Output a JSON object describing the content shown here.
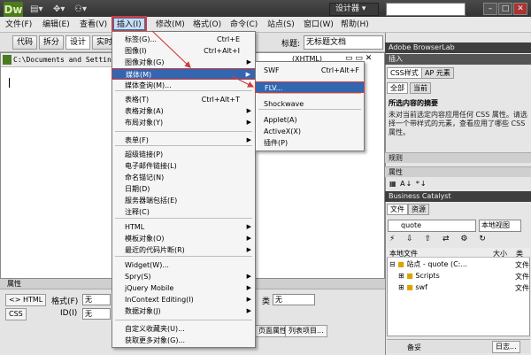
{
  "app": {
    "logo": "Dw",
    "workspace_switch": "设计器 ▾"
  },
  "menubar": {
    "items": [
      "文件(F)",
      "编辑(E)",
      "查看(V)",
      "插入(I)",
      "修改(M)",
      "格式(O)",
      "命令(C)",
      "站点(S)",
      "窗口(W)",
      "帮助(H)"
    ]
  },
  "toolbar": {
    "code": "代码",
    "split": "拆分",
    "design": "设计",
    "live": "实时",
    "title_label": "标题:",
    "title_value": "无标题文档"
  },
  "document": {
    "path": "C:\\Documents and Settings",
    "badge": "(XHTML)",
    "controls": "▭ ▭ ✕"
  },
  "properties": {
    "header": "属性",
    "html_tab": "<> HTML",
    "css_tab": "CSS",
    "format_label": "格式(F)",
    "format_value": "无",
    "class_label": "类",
    "class_value": "无",
    "id_label": "ID(I)",
    "id_value": "无",
    "page_props": "页面属性...",
    "list_item": "列表项目..."
  },
  "insert_menu": {
    "items": [
      {
        "label": "标签(G)...",
        "shortcut": "Ctrl+E",
        "submenu": false
      },
      {
        "label": "图像(I)",
        "shortcut": "Ctrl+Alt+I",
        "submenu": false
      },
      {
        "label": "图像对象(G)",
        "shortcut": "",
        "submenu": true
      },
      {
        "label": "媒体(M)",
        "shortcut": "",
        "submenu": true
      },
      {
        "label": "媒体查询(M)...",
        "shortcut": "",
        "submenu": false
      },
      {
        "label": "表格(T)",
        "shortcut": "Ctrl+Alt+T",
        "submenu": false
      },
      {
        "label": "表格对象(A)",
        "shortcut": "",
        "submenu": true
      },
      {
        "label": "布局对象(Y)",
        "shortcut": "",
        "submenu": true
      },
      {
        "label": "表单(F)",
        "shortcut": "",
        "submenu": true
      },
      {
        "label": "超级链接(P)",
        "shortcut": "",
        "submenu": false
      },
      {
        "label": "电子邮件链接(L)",
        "shortcut": "",
        "submenu": false
      },
      {
        "label": "命名锚记(N)",
        "shortcut": "",
        "submenu": false
      },
      {
        "label": "日期(D)",
        "shortcut": "",
        "submenu": false
      },
      {
        "label": "服务器端包括(E)",
        "shortcut": "",
        "submenu": false
      },
      {
        "label": "注释(C)",
        "shortcut": "",
        "submenu": false
      },
      {
        "label": "HTML",
        "shortcut": "",
        "submenu": true
      },
      {
        "label": "模板对象(O)",
        "shortcut": "",
        "submenu": true
      },
      {
        "label": "最近的代码片断(R)",
        "shortcut": "",
        "submenu": true
      },
      {
        "label": "Widget(W)...",
        "shortcut": "",
        "submenu": false
      },
      {
        "label": "Spry(S)",
        "shortcut": "",
        "submenu": true
      },
      {
        "label": "jQuery Mobile",
        "shortcut": "",
        "submenu": true
      },
      {
        "label": "InContext Editing(I)",
        "shortcut": "",
        "submenu": true
      },
      {
        "label": "数据对象(J)",
        "shortcut": "",
        "submenu": true
      },
      {
        "label": "自定义收藏夹(U)...",
        "shortcut": "",
        "submenu": false
      },
      {
        "label": "获取更多对象(G)...",
        "shortcut": "",
        "submenu": false
      }
    ]
  },
  "media_submenu": {
    "items": [
      {
        "label": "SWF",
        "shortcut": "Ctrl+Alt+F"
      },
      {
        "label": "FLV...",
        "shortcut": ""
      },
      {
        "label": "Shockwave",
        "shortcut": ""
      },
      {
        "label": "Applet(A)",
        "shortcut": ""
      },
      {
        "label": "ActiveX(X)",
        "shortcut": ""
      },
      {
        "label": "插件(P)",
        "shortcut": ""
      }
    ]
  },
  "right_panel": {
    "browserlab": "Adobe BrowserLab",
    "insert": "插入",
    "css_tab": "CSS样式",
    "ap_tab": "AP 元素",
    "all_tab": "全部",
    "current_tab": "当前",
    "summary_title": "所选内容的摘要",
    "summary_text": "未对当前选定内容应用任何 CSS 属性。请选择一个带样式的元素，查看应用了哪些 CSS 属性。",
    "rules": "规则",
    "attributes": "属性",
    "business_catalyst": "Business Catalyst",
    "files_tab": "文件",
    "assets_tab": "资源",
    "site_select": "quote",
    "view_select": "本地视图",
    "col_local": "本地文件",
    "col_size": "大小",
    "col_type": "类",
    "site_row": "站点 - quote (C:...",
    "site_type": "文件",
    "folder1": "Scripts",
    "folder1_type": "文件",
    "folder2": "swf",
    "folder2_type": "文件",
    "log_button": "日志...",
    "status_text": "备妥"
  },
  "colors": {
    "highlight": "#3366b0",
    "annotation": "#d23b3b"
  }
}
